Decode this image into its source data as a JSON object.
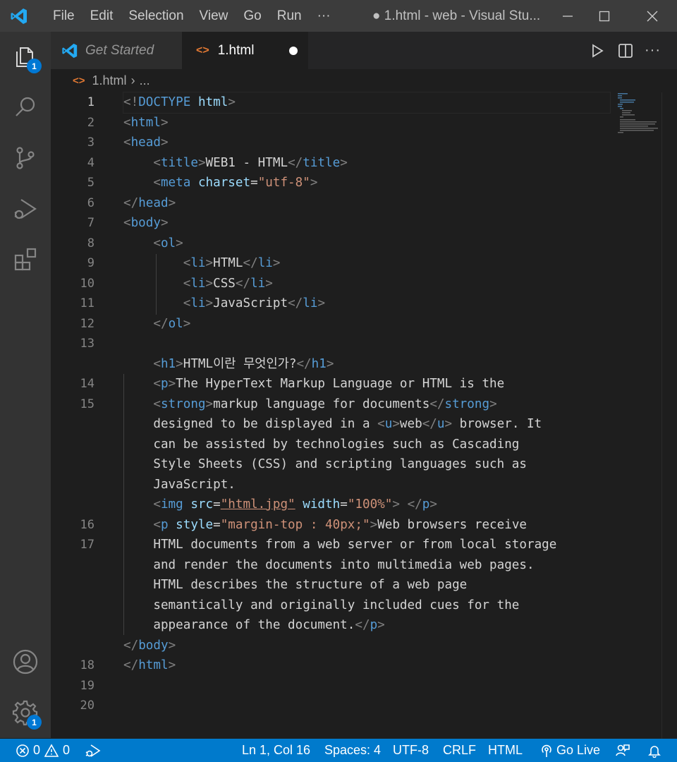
{
  "titlebar": {
    "menu": [
      "File",
      "Edit",
      "Selection",
      "View",
      "Go",
      "Run",
      "···"
    ],
    "title": "● 1.html - web - Visual Stu..."
  },
  "activity_bar": {
    "explorer_badge": "1",
    "settings_badge": "1"
  },
  "tabs": [
    {
      "label": "Get Started",
      "icon": "vscode-logo-icon"
    },
    {
      "label": "1.html",
      "icon": "html-file-icon",
      "modified": true
    }
  ],
  "breadcrumb": {
    "file": "1.html",
    "rest": "..."
  },
  "editor": {
    "current_line": 1,
    "line_numbers": [
      "1",
      "2",
      "3",
      "4",
      "5",
      "6",
      "7",
      "8",
      "9",
      "10",
      "11",
      "12",
      "13",
      "",
      "14",
      "15",
      "",
      "",
      "",
      "",
      "",
      "16",
      "17",
      "",
      "",
      "",
      "",
      "",
      "18",
      "19",
      "20"
    ],
    "lines": [
      [
        [
          "p",
          "<!"
        ],
        [
          "t",
          "DOCTYPE"
        ],
        [
          "d",
          " "
        ],
        [
          "a",
          "html"
        ],
        [
          "p",
          ">"
        ]
      ],
      [
        [
          "p",
          "<"
        ],
        [
          "t",
          "html"
        ],
        [
          "p",
          ">"
        ]
      ],
      [
        [
          "p",
          "<"
        ],
        [
          "t",
          "head"
        ],
        [
          "p",
          ">"
        ]
      ],
      [
        [
          "d",
          "    "
        ],
        [
          "p",
          "<"
        ],
        [
          "t",
          "title"
        ],
        [
          "p",
          ">"
        ],
        [
          "d",
          "WEB1 - HTML"
        ],
        [
          "p",
          "</"
        ],
        [
          "t",
          "title"
        ],
        [
          "p",
          ">"
        ]
      ],
      [
        [
          "d",
          "    "
        ],
        [
          "p",
          "<"
        ],
        [
          "t",
          "meta"
        ],
        [
          "d",
          " "
        ],
        [
          "a",
          "charset"
        ],
        [
          "d",
          "="
        ],
        [
          "s",
          "\"utf-8\""
        ],
        [
          "p",
          ">"
        ]
      ],
      [
        [
          "p",
          "</"
        ],
        [
          "t",
          "head"
        ],
        [
          "p",
          ">"
        ]
      ],
      [
        [
          "p",
          "<"
        ],
        [
          "t",
          "body"
        ],
        [
          "p",
          ">"
        ]
      ],
      [
        [
          "d",
          "    "
        ],
        [
          "p",
          "<"
        ],
        [
          "t",
          "ol"
        ],
        [
          "p",
          ">"
        ]
      ],
      [
        [
          "d",
          "        "
        ],
        [
          "p",
          "<"
        ],
        [
          "t",
          "li"
        ],
        [
          "p",
          ">"
        ],
        [
          "d",
          "HTML"
        ],
        [
          "p",
          "</"
        ],
        [
          "t",
          "li"
        ],
        [
          "p",
          ">"
        ]
      ],
      [
        [
          "d",
          "        "
        ],
        [
          "p",
          "<"
        ],
        [
          "t",
          "li"
        ],
        [
          "p",
          ">"
        ],
        [
          "d",
          "CSS"
        ],
        [
          "p",
          "</"
        ],
        [
          "t",
          "li"
        ],
        [
          "p",
          ">"
        ]
      ],
      [
        [
          "d",
          "        "
        ],
        [
          "p",
          "<"
        ],
        [
          "t",
          "li"
        ],
        [
          "p",
          ">"
        ],
        [
          "d",
          "JavaScript"
        ],
        [
          "p",
          "</"
        ],
        [
          "t",
          "li"
        ],
        [
          "p",
          ">"
        ]
      ],
      [
        [
          "d",
          "    "
        ],
        [
          "p",
          "</"
        ],
        [
          "t",
          "ol"
        ],
        [
          "p",
          ">"
        ]
      ],
      [],
      [
        [
          "d",
          "    "
        ],
        [
          "p",
          "<"
        ],
        [
          "t",
          "h1"
        ],
        [
          "p",
          ">"
        ],
        [
          "d",
          "HTML이란 무엇인가?"
        ],
        [
          "p",
          "</"
        ],
        [
          "t",
          "h1"
        ],
        [
          "p",
          ">"
        ]
      ],
      [
        [
          "d",
          "    "
        ],
        [
          "p",
          "<"
        ],
        [
          "t",
          "p"
        ],
        [
          "p",
          ">"
        ],
        [
          "d",
          "The HyperText Markup Language or HTML is the"
        ]
      ],
      [
        [
          "d",
          "    "
        ],
        [
          "p",
          "<"
        ],
        [
          "t",
          "strong"
        ],
        [
          "p",
          ">"
        ],
        [
          "d",
          "markup language for documents"
        ],
        [
          "p",
          "</"
        ],
        [
          "t",
          "strong"
        ],
        [
          "p",
          ">"
        ]
      ],
      [
        [
          "d",
          "    designed to be displayed in a "
        ],
        [
          "p",
          "<"
        ],
        [
          "t",
          "u"
        ],
        [
          "p",
          ">"
        ],
        [
          "d",
          "web"
        ],
        [
          "p",
          "</"
        ],
        [
          "t",
          "u"
        ],
        [
          "p",
          ">"
        ],
        [
          "d",
          " browser. It"
        ]
      ],
      [
        [
          "d",
          "    can be assisted by technologies such as Cascading"
        ]
      ],
      [
        [
          "d",
          "    Style Sheets (CSS) and scripting languages such as"
        ]
      ],
      [
        [
          "d",
          "    JavaScript."
        ]
      ],
      [
        [
          "d",
          "    "
        ],
        [
          "p",
          "<"
        ],
        [
          "t",
          "img"
        ],
        [
          "d",
          " "
        ],
        [
          "a",
          "src"
        ],
        [
          "d",
          "="
        ],
        [
          "su",
          "\"html.jpg\""
        ],
        [
          "d",
          " "
        ],
        [
          "a",
          "width"
        ],
        [
          "d",
          "="
        ],
        [
          "s",
          "\"100%\""
        ],
        [
          "p",
          ">"
        ],
        [
          "d",
          " "
        ],
        [
          "p",
          "</"
        ],
        [
          "t",
          "p"
        ],
        [
          "p",
          ">"
        ]
      ],
      [
        [
          "d",
          "    "
        ],
        [
          "p",
          "<"
        ],
        [
          "t",
          "p"
        ],
        [
          "d",
          " "
        ],
        [
          "a",
          "style"
        ],
        [
          "d",
          "="
        ],
        [
          "s",
          "\"margin-top : 40px;\""
        ],
        [
          "p",
          ">"
        ],
        [
          "d",
          "Web browsers receive"
        ]
      ],
      [
        [
          "d",
          "    HTML documents from a web server or from local storage"
        ]
      ],
      [
        [
          "d",
          "    and render the documents into multimedia web pages."
        ]
      ],
      [
        [
          "d",
          "    HTML describes the structure of a web page"
        ]
      ],
      [
        [
          "d",
          "    semantically and originally included cues for the"
        ]
      ],
      [
        [
          "d",
          "    appearance of the document."
        ],
        [
          "p",
          "</"
        ],
        [
          "t",
          "p"
        ],
        [
          "p",
          ">"
        ]
      ],
      [
        [
          "p",
          "</"
        ],
        [
          "t",
          "body"
        ],
        [
          "p",
          ">"
        ]
      ],
      [
        [
          "p",
          "</"
        ],
        [
          "t",
          "html"
        ],
        [
          "p",
          ">"
        ]
      ],
      []
    ]
  },
  "statusbar": {
    "errors": "0",
    "warnings": "0",
    "position": "Ln 1, Col 16",
    "spaces": "Spaces: 4",
    "encoding": "UTF-8",
    "eol": "CRLF",
    "language": "HTML",
    "golive": "Go Live"
  },
  "colors": {
    "tag": "#569cd6",
    "punct": "#808080",
    "attr": "#9cdcfe",
    "string": "#ce9178",
    "text": "#d4d4d4",
    "statusbar": "#007acc",
    "badge": "#0078d4"
  }
}
